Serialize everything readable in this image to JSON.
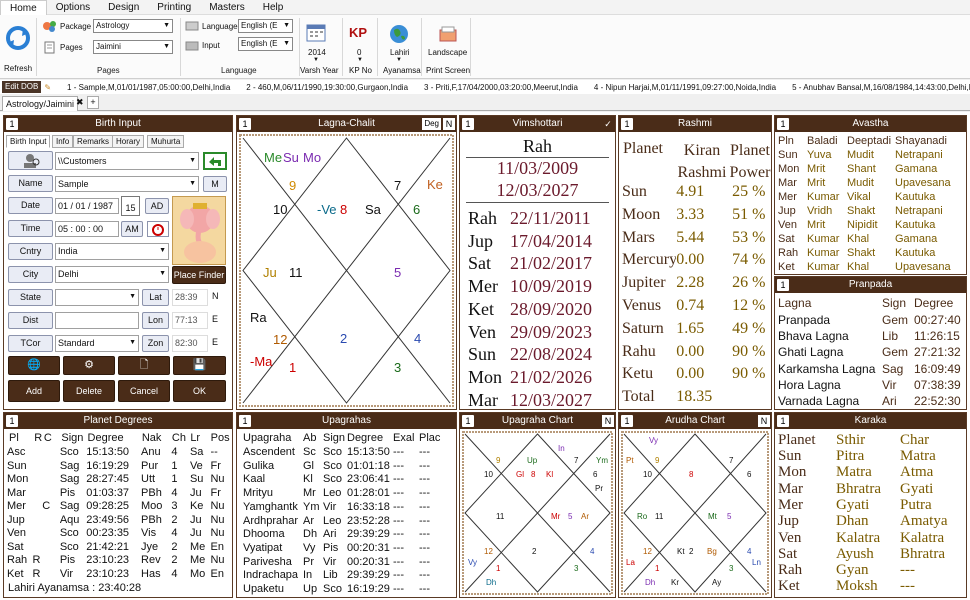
{
  "menu": [
    "Home",
    "Options",
    "Design",
    "Printing",
    "Masters",
    "Help"
  ],
  "ribbon": {
    "refresh": "Refresh",
    "package_label": "Package",
    "package_value": "Astrology",
    "pages_label": "Pages",
    "pages_value": "Jaimini",
    "pages_group": "Pages",
    "language_label": "Language",
    "language_value": "English (E",
    "input_label": "Input",
    "input_value": "English (E",
    "language_group": "Language",
    "year_value": "2014",
    "year_label": "Varsh Year",
    "kp_value": "0",
    "kp_label": "KP No",
    "lahiri_label": "Lahiri",
    "ayanamsa_label": "Ayanamsa",
    "landscape_label": "Landscape",
    "print_label": "Print Screen"
  },
  "recent": {
    "edit_dob": "Edit DOB",
    "items": [
      "1 - Sample,M,01/01/1987,05:00:00,Delhi,India",
      "2 - 460,M,06/11/1990,19:30:00,Gurgaon,India",
      "3 - Priti,F,17/04/2000,03:20:00,Meerut,India",
      "4 - Nipun Harjai,M,01/11/1991,09:27:00,Noida,India",
      "5 - Anubhav Bansal,M,16/08/1984,14:43:00,Delhi,India"
    ]
  },
  "doc_tab": "Astrology/Jaimini",
  "birth": {
    "title": "Birth Input",
    "num": "1",
    "tabs": [
      "Birth Input",
      "Info",
      "Remarks",
      "Horary",
      "Muhurta"
    ],
    "path": "\\\\Customers",
    "name_label": "Name",
    "name_value": "Sample",
    "m_btn": "M",
    "date_label": "Date",
    "date_value": "01 / 01 / 1987",
    "cal_day": "15",
    "ad": "AD",
    "time_label": "Time",
    "time_value": "05 : 00 : 00",
    "am": "AM",
    "cntry_label": "Cntry",
    "cntry_value": "India",
    "city_label": "City",
    "city_value": "Delhi",
    "place_finder": "Place Finder",
    "state_label": "State",
    "lat_label": "Lat",
    "lat_value": "28:39",
    "lat_dir": "N",
    "dist_label": "Dist",
    "lon_label": "Lon",
    "lon_value": "77:13",
    "lon_dir": "E",
    "tcor_label": "TCor",
    "tcor_value": "Standard",
    "zon_label": "Zon",
    "zon_value": "82:30",
    "zon_dir": "E",
    "btn_add": "Add",
    "btn_delete": "Delete",
    "btn_cancel": "Cancel",
    "btn_ok": "OK"
  },
  "lagna": {
    "title": "Lagna-Chalit",
    "num": "1",
    "deg": "Deg",
    "n": "N"
  },
  "vimshottari": {
    "title": "Vimshottari",
    "num": "1",
    "check": "✓",
    "head": "Rah",
    "start": "11/03/2009",
    "end": "12/03/2027",
    "rows": [
      [
        "Rah",
        "22/11/2011"
      ],
      [
        "Jup",
        "17/04/2014"
      ],
      [
        "Sat",
        "21/02/2017"
      ],
      [
        "Mer",
        "10/09/2019"
      ],
      [
        "Ket",
        "28/09/2020"
      ],
      [
        "Ven",
        "29/09/2023"
      ],
      [
        "Sun",
        "22/08/2024"
      ],
      [
        "Mon",
        "21/02/2026"
      ],
      [
        "Mar",
        "12/03/2027"
      ]
    ]
  },
  "rashmi": {
    "title": "Rashmi",
    "num": "1",
    "headers": [
      "Planet",
      "Kiran Rashmi",
      "Planet Power"
    ],
    "rows": [
      [
        "Sun",
        "4.91",
        "25 %"
      ],
      [
        "Moon",
        "3.33",
        "51 %"
      ],
      [
        "Mars",
        "5.44",
        "53 %"
      ],
      [
        "Mercury",
        "0.00",
        "74 %"
      ],
      [
        "Jupiter",
        "2.28",
        "26 %"
      ],
      [
        "Venus",
        "0.74",
        "12 %"
      ],
      [
        "Saturn",
        "1.65",
        "49 %"
      ],
      [
        "Rahu",
        "0.00",
        "90 %"
      ],
      [
        "Ketu",
        "0.00",
        "90 %"
      ],
      [
        "Total",
        "18.35",
        ""
      ]
    ]
  },
  "avastha": {
    "title": "Avastha",
    "num": "1",
    "headers": [
      "Pln",
      "Baladi",
      "Deeptadi",
      "Shayanadi"
    ],
    "rows": [
      [
        "Sun",
        "Yuva",
        "Mudit",
        "Netrapani"
      ],
      [
        "Mon",
        "Mrit",
        "Shant",
        "Gamana"
      ],
      [
        "Mar",
        "Mrit",
        "Mudit",
        "Upavesana"
      ],
      [
        "Mer",
        "Kumar",
        "Vikal",
        "Kautuka"
      ],
      [
        "Jup",
        "Vridh",
        "Shakt",
        "Netrapani"
      ],
      [
        "Ven",
        "Mrit",
        "Nipidit",
        "Kautuka"
      ],
      [
        "Sat",
        "Kumar",
        "Khal",
        "Gamana"
      ],
      [
        "Rah",
        "Kumar",
        "Shakt",
        "Kautuka"
      ],
      [
        "Ket",
        "Kumar",
        "Khal",
        "Upavesana"
      ]
    ]
  },
  "pranpada": {
    "title": "Pranpada",
    "num": "1",
    "headers": [
      "Lagna",
      "Sign",
      "Degree"
    ],
    "rows": [
      [
        "Pranpada",
        "Gem",
        "00:27:40"
      ],
      [
        "Bhava Lagna",
        "Lib",
        "11:26:15"
      ],
      [
        "Ghati Lagna",
        "Gem",
        "27:21:32"
      ],
      [
        "Karkamsha Lagna",
        "Sag",
        "16:09:49"
      ],
      [
        "Hora Lagna",
        "Vir",
        "07:38:39"
      ],
      [
        "Varnada Lagna",
        "Ari",
        "22:52:30"
      ]
    ]
  },
  "planet_degrees": {
    "title": "Planet Degrees",
    "num": "1",
    "headers": [
      "Pl",
      "R",
      "C",
      "Sign",
      "Degree",
      "Nak",
      "Ch",
      "Lr",
      "Pos"
    ],
    "rows": [
      [
        "Asc",
        "",
        "",
        "Sco",
        "15:13:50",
        "Anu",
        "4",
        "Sa",
        "--"
      ],
      [
        "Sun",
        "",
        "",
        "Sag",
        "16:19:29",
        "Pur",
        "1",
        "Ve",
        "Fr"
      ],
      [
        "Mon",
        "",
        "",
        "Sag",
        "28:27:45",
        "Utt",
        "1",
        "Su",
        "Nu"
      ],
      [
        "Mar",
        "",
        "",
        "Pis",
        "01:03:37",
        "PBh",
        "4",
        "Ju",
        "Fr"
      ],
      [
        "Mer",
        "",
        "C",
        "Sag",
        "09:28:25",
        "Moo",
        "3",
        "Ke",
        "Nu"
      ],
      [
        "Jup",
        "",
        "",
        "Aqu",
        "23:49:56",
        "PBh",
        "2",
        "Ju",
        "Nu"
      ],
      [
        "Ven",
        "",
        "",
        "Sco",
        "00:23:35",
        "Vis",
        "4",
        "Ju",
        "Nu"
      ],
      [
        "Sat",
        "",
        "",
        "Sco",
        "21:42:21",
        "Jye",
        "2",
        "Me",
        "En"
      ],
      [
        "Rah",
        "R",
        "",
        "Pis",
        "23:10:23",
        "Rev",
        "2",
        "Me",
        "Nu"
      ],
      [
        "Ket",
        "R",
        "",
        "Vir",
        "23:10:23",
        "Has",
        "4",
        "Mo",
        "En"
      ]
    ],
    "footer": "Lahiri Ayanamsa : 23:40:28"
  },
  "upagrahas": {
    "title": "Upagrahas",
    "num": "1",
    "headers": [
      "Upagraha",
      "Ab",
      "Sign",
      "Degree",
      "Exal",
      "Plac"
    ],
    "rows": [
      [
        "Ascendent",
        "Sc",
        "Sco",
        "15:13:50",
        "---",
        "---"
      ],
      [
        "Gulika",
        "Gl",
        "Sco",
        "01:01:18",
        "---",
        "---"
      ],
      [
        "Kaal",
        "Kl",
        "Sco",
        "23:06:41",
        "---",
        "---"
      ],
      [
        "Mrityu",
        "Mr",
        "Leo",
        "01:28:01",
        "---",
        "---"
      ],
      [
        "Yamghantk",
        "Ym",
        "Vir",
        "16:33:18",
        "---",
        "---"
      ],
      [
        "Ardhprahar",
        "Ar",
        "Leo",
        "23:52:28",
        "---",
        "---"
      ],
      [
        "Dhooma",
        "Dh",
        "Ari",
        "29:39:29",
        "---",
        "---"
      ],
      [
        "Vyatipat",
        "Vy",
        "Pis",
        "00:20:31",
        "---",
        "---"
      ],
      [
        "Parivesha",
        "Pr",
        "Vir",
        "00:20:31",
        "---",
        "---"
      ],
      [
        "Indrachapa",
        "In",
        "Lib",
        "29:39:29",
        "---",
        "---"
      ],
      [
        "Upaketu",
        "Up",
        "Sco",
        "16:19:29",
        "---",
        "---"
      ]
    ]
  },
  "upagraha_chart": {
    "title": "Upagraha Chart",
    "num": "1",
    "n": "N"
  },
  "arudha_chart": {
    "title": "Arudha Chart",
    "num": "1",
    "n": "N"
  },
  "karaka": {
    "title": "Karaka",
    "num": "1",
    "headers": [
      "Planet",
      "Sthir",
      "Char"
    ],
    "rows": [
      [
        "Sun",
        "Pitra",
        "Matra"
      ],
      [
        "Mon",
        "Matra",
        "Atma"
      ],
      [
        "Mar",
        "Bhratra",
        "Gyati"
      ],
      [
        "Mer",
        "Gyati",
        "Putra"
      ],
      [
        "Jup",
        "Dhan",
        "Amatya"
      ],
      [
        "Ven",
        "Kalatra",
        "Kalatra"
      ],
      [
        "Sat",
        "Ayush",
        "Bhratra"
      ],
      [
        "Rah",
        "Gyan",
        "---"
      ],
      [
        "Ket",
        "Moksh",
        "---"
      ]
    ]
  },
  "colors": {
    "brown": "#4a2c18",
    "maroon": "#6b1a2c",
    "gold": "#7a5b00",
    "red": "#c00000"
  }
}
